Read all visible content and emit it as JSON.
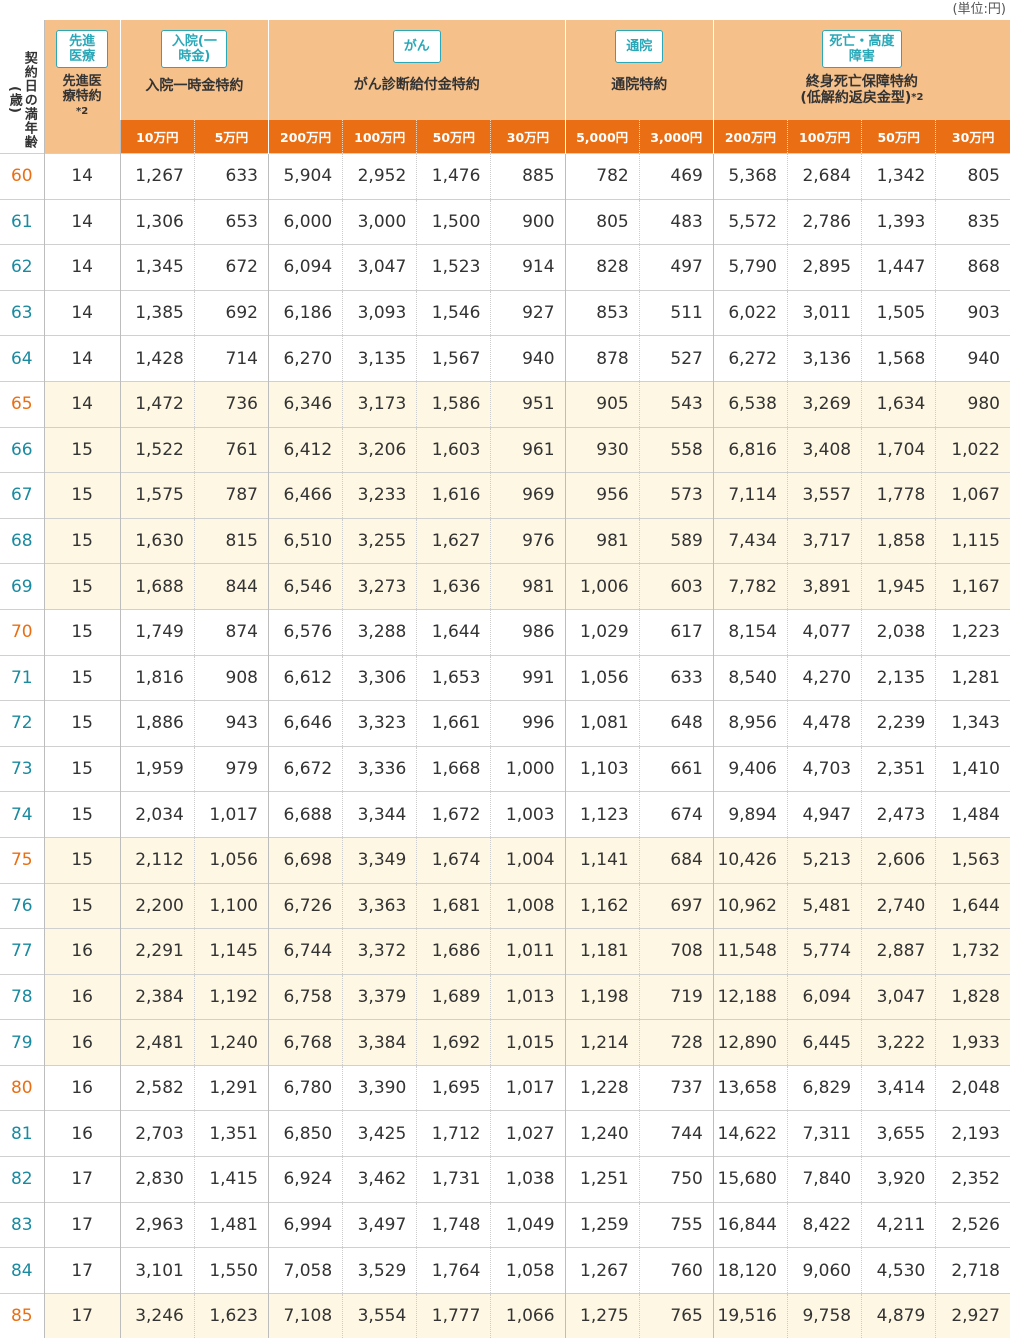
{
  "unit_note": "(単位:円)",
  "age_header": "契約日の満年齢(歳)",
  "groups": {
    "senshin": {
      "badge": "先進医療",
      "label": "先進医療特約",
      "mark": "*2"
    },
    "nyuin": {
      "badge": "入院(一時金)",
      "label": "入院一時金特約"
    },
    "gan": {
      "badge": "がん",
      "label": "がん診断給付金特約"
    },
    "tsuin": {
      "badge": "通院",
      "label": "通院特約"
    },
    "shibo": {
      "badge": "死亡・高度障害",
      "label_line1": "終身死亡保障特約",
      "label_line2": "(低解約返戻金型)",
      "mark": "*2"
    }
  },
  "subheaders": [
    "10万円",
    "5万円",
    "200万円",
    "100万円",
    "50万円",
    "30万円",
    "5,000円",
    "3,000円",
    "200万円",
    "100万円",
    "50万円",
    "30万円"
  ],
  "colors": {
    "header_bg": "#f6c08b",
    "subheader_bg": "#ea6f14",
    "badge_teal": "#2aa8b8",
    "highlight_row": "#fdf7e3",
    "age_orange": "#ea6f14",
    "age_teal": "#1a8aa0"
  },
  "rows": [
    {
      "age": "60",
      "v": [
        "14",
        "1,267",
        "633",
        "5,904",
        "2,952",
        "1,476",
        "885",
        "782",
        "469",
        "5,368",
        "2,684",
        "1,342",
        "805"
      ]
    },
    {
      "age": "61",
      "v": [
        "14",
        "1,306",
        "653",
        "6,000",
        "3,000",
        "1,500",
        "900",
        "805",
        "483",
        "5,572",
        "2,786",
        "1,393",
        "835"
      ]
    },
    {
      "age": "62",
      "v": [
        "14",
        "1,345",
        "672",
        "6,094",
        "3,047",
        "1,523",
        "914",
        "828",
        "497",
        "5,790",
        "2,895",
        "1,447",
        "868"
      ]
    },
    {
      "age": "63",
      "v": [
        "14",
        "1,385",
        "692",
        "6,186",
        "3,093",
        "1,546",
        "927",
        "853",
        "511",
        "6,022",
        "3,011",
        "1,505",
        "903"
      ]
    },
    {
      "age": "64",
      "v": [
        "14",
        "1,428",
        "714",
        "6,270",
        "3,135",
        "1,567",
        "940",
        "878",
        "527",
        "6,272",
        "3,136",
        "1,568",
        "940"
      ]
    },
    {
      "age": "65",
      "v": [
        "14",
        "1,472",
        "736",
        "6,346",
        "3,173",
        "1,586",
        "951",
        "905",
        "543",
        "6,538",
        "3,269",
        "1,634",
        "980"
      ]
    },
    {
      "age": "66",
      "v": [
        "15",
        "1,522",
        "761",
        "6,412",
        "3,206",
        "1,603",
        "961",
        "930",
        "558",
        "6,816",
        "3,408",
        "1,704",
        "1,022"
      ]
    },
    {
      "age": "67",
      "v": [
        "15",
        "1,575",
        "787",
        "6,466",
        "3,233",
        "1,616",
        "969",
        "956",
        "573",
        "7,114",
        "3,557",
        "1,778",
        "1,067"
      ]
    },
    {
      "age": "68",
      "v": [
        "15",
        "1,630",
        "815",
        "6,510",
        "3,255",
        "1,627",
        "976",
        "981",
        "589",
        "7,434",
        "3,717",
        "1,858",
        "1,115"
      ]
    },
    {
      "age": "69",
      "v": [
        "15",
        "1,688",
        "844",
        "6,546",
        "3,273",
        "1,636",
        "981",
        "1,006",
        "603",
        "7,782",
        "3,891",
        "1,945",
        "1,167"
      ]
    },
    {
      "age": "70",
      "v": [
        "15",
        "1,749",
        "874",
        "6,576",
        "3,288",
        "1,644",
        "986",
        "1,029",
        "617",
        "8,154",
        "4,077",
        "2,038",
        "1,223"
      ]
    },
    {
      "age": "71",
      "v": [
        "15",
        "1,816",
        "908",
        "6,612",
        "3,306",
        "1,653",
        "991",
        "1,056",
        "633",
        "8,540",
        "4,270",
        "2,135",
        "1,281"
      ]
    },
    {
      "age": "72",
      "v": [
        "15",
        "1,886",
        "943",
        "6,646",
        "3,323",
        "1,661",
        "996",
        "1,081",
        "648",
        "8,956",
        "4,478",
        "2,239",
        "1,343"
      ]
    },
    {
      "age": "73",
      "v": [
        "15",
        "1,959",
        "979",
        "6,672",
        "3,336",
        "1,668",
        "1,000",
        "1,103",
        "661",
        "9,406",
        "4,703",
        "2,351",
        "1,410"
      ]
    },
    {
      "age": "74",
      "v": [
        "15",
        "2,034",
        "1,017",
        "6,688",
        "3,344",
        "1,672",
        "1,003",
        "1,123",
        "674",
        "9,894",
        "4,947",
        "2,473",
        "1,484"
      ]
    },
    {
      "age": "75",
      "v": [
        "15",
        "2,112",
        "1,056",
        "6,698",
        "3,349",
        "1,674",
        "1,004",
        "1,141",
        "684",
        "10,426",
        "5,213",
        "2,606",
        "1,563"
      ]
    },
    {
      "age": "76",
      "v": [
        "15",
        "2,200",
        "1,100",
        "6,726",
        "3,363",
        "1,681",
        "1,008",
        "1,162",
        "697",
        "10,962",
        "5,481",
        "2,740",
        "1,644"
      ]
    },
    {
      "age": "77",
      "v": [
        "16",
        "2,291",
        "1,145",
        "6,744",
        "3,372",
        "1,686",
        "1,011",
        "1,181",
        "708",
        "11,548",
        "5,774",
        "2,887",
        "1,732"
      ]
    },
    {
      "age": "78",
      "v": [
        "16",
        "2,384",
        "1,192",
        "6,758",
        "3,379",
        "1,689",
        "1,013",
        "1,198",
        "719",
        "12,188",
        "6,094",
        "3,047",
        "1,828"
      ]
    },
    {
      "age": "79",
      "v": [
        "16",
        "2,481",
        "1,240",
        "6,768",
        "3,384",
        "1,692",
        "1,015",
        "1,214",
        "728",
        "12,890",
        "6,445",
        "3,222",
        "1,933"
      ]
    },
    {
      "age": "80",
      "v": [
        "16",
        "2,582",
        "1,291",
        "6,780",
        "3,390",
        "1,695",
        "1,017",
        "1,228",
        "737",
        "13,658",
        "6,829",
        "3,414",
        "2,048"
      ]
    },
    {
      "age": "81",
      "v": [
        "16",
        "2,703",
        "1,351",
        "6,850",
        "3,425",
        "1,712",
        "1,027",
        "1,240",
        "744",
        "14,622",
        "7,311",
        "3,655",
        "2,193"
      ]
    },
    {
      "age": "82",
      "v": [
        "17",
        "2,830",
        "1,415",
        "6,924",
        "3,462",
        "1,731",
        "1,038",
        "1,251",
        "750",
        "15,680",
        "7,840",
        "3,920",
        "2,352"
      ]
    },
    {
      "age": "83",
      "v": [
        "17",
        "2,963",
        "1,481",
        "6,994",
        "3,497",
        "1,748",
        "1,049",
        "1,259",
        "755",
        "16,844",
        "8,422",
        "4,211",
        "2,526"
      ]
    },
    {
      "age": "84",
      "v": [
        "17",
        "3,101",
        "1,550",
        "7,058",
        "3,529",
        "1,764",
        "1,058",
        "1,267",
        "760",
        "18,120",
        "9,060",
        "4,530",
        "2,718"
      ]
    },
    {
      "age": "85",
      "v": [
        "17",
        "3,246",
        "1,623",
        "7,108",
        "3,554",
        "1,777",
        "1,066",
        "1,275",
        "765",
        "19,516",
        "9,758",
        "4,879",
        "2,927"
      ]
    }
  ]
}
